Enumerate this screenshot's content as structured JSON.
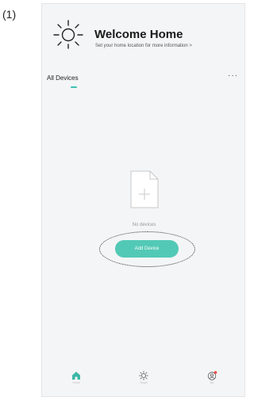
{
  "figure_label": "(1)",
  "header": {
    "title": "Welcome Home",
    "subtitle": "Set your home location for more information >",
    "icon": "sun-icon"
  },
  "devices": {
    "section_label": "All Devices",
    "more_label": "···",
    "empty_text": "No devices",
    "add_button_label": "Add Device"
  },
  "tabbar": {
    "items": [
      {
        "label": "Home",
        "icon": "home-icon",
        "active": true
      },
      {
        "label": "Smart",
        "icon": "smart-icon",
        "active": false
      },
      {
        "label": "Me",
        "icon": "me-icon",
        "active": false
      }
    ]
  },
  "colors": {
    "accent": "#52c9b6",
    "background": "#f4f5f6",
    "notification_dot": "#e94545"
  }
}
